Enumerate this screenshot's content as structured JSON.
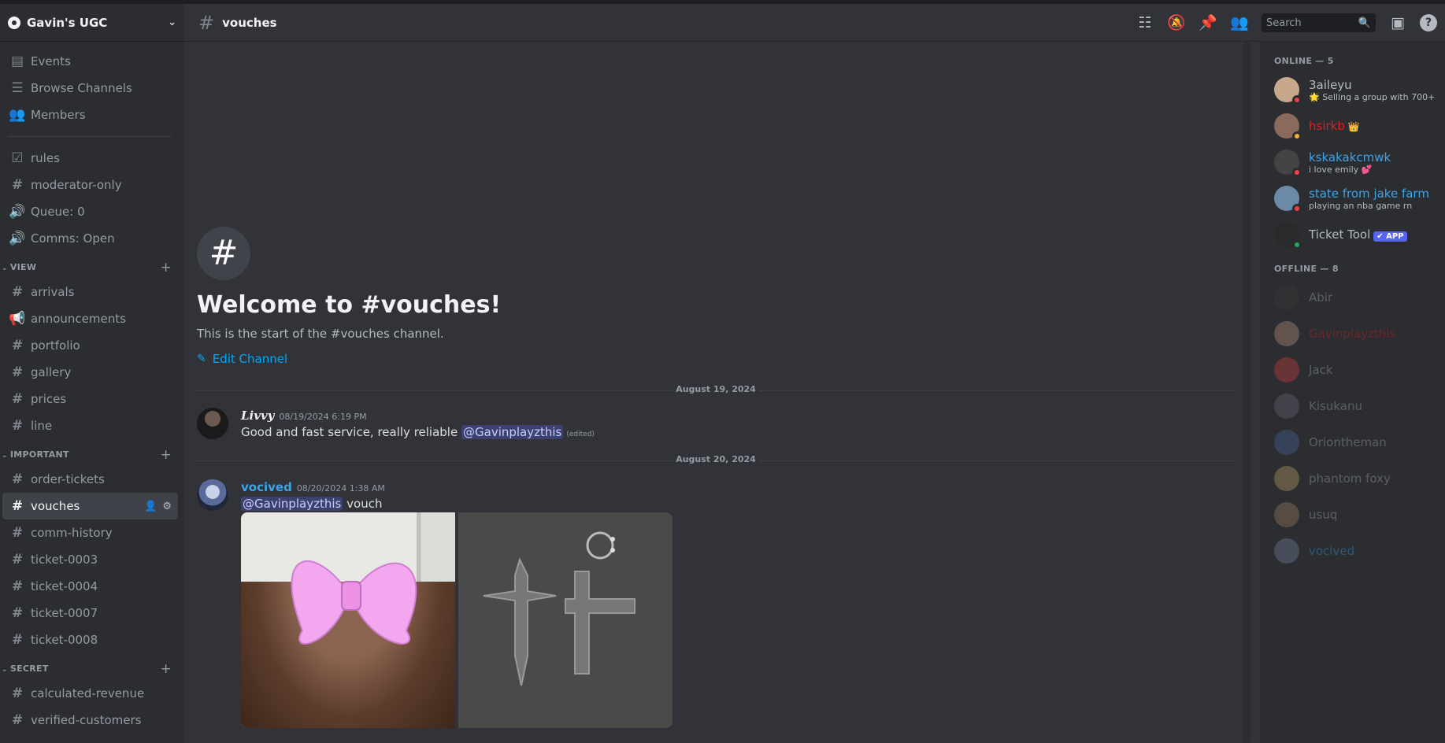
{
  "guild": {
    "name": "Gavin's UGC"
  },
  "sidebar": {
    "top_items": [
      {
        "label": "Events",
        "icon": "calendar-icon"
      },
      {
        "label": "Browse Channels",
        "icon": "browse-channels-icon"
      },
      {
        "label": "Members",
        "icon": "members-icon"
      }
    ],
    "ungrouped": [
      {
        "label": "rules",
        "icon": "rules-icon"
      },
      {
        "label": "moderator-only",
        "icon": "hash-icon"
      },
      {
        "label": "Queue: 0",
        "icon": "voice-icon"
      },
      {
        "label": "Comms: Open",
        "icon": "voice-icon"
      }
    ],
    "categories": [
      {
        "name": "VIEW",
        "channels": [
          "arrivals",
          "announcements",
          "portfolio",
          "gallery",
          "prices",
          "line"
        ]
      },
      {
        "name": "IMPORTANT",
        "channels": [
          "order-tickets",
          "vouches",
          "comm-history",
          "ticket-0003",
          "ticket-0004",
          "ticket-0007",
          "ticket-0008"
        ]
      },
      {
        "name": "SECRET",
        "channels": [
          "calculated-revenue",
          "verified-customers"
        ]
      }
    ],
    "active_channel": "vouches"
  },
  "topbar": {
    "channel": "vouches",
    "search_placeholder": "Search"
  },
  "welcome": {
    "title": "Welcome to #vouches!",
    "subtitle": "This is the start of the #vouches channel.",
    "edit_label": "Edit Channel"
  },
  "messages": [
    {
      "date": "August 19, 2024",
      "author": "Livvy",
      "author_color": "#f2f3f5",
      "timestamp": "08/19/2024 6:19 PM",
      "text": "Good and fast service, really reliable",
      "mention": "@Gavinplayzthis",
      "edited": "(edited)"
    },
    {
      "date": "August 20, 2024",
      "author": "vocived",
      "author_color": "#3ba5ec",
      "timestamp": "08/20/2024 1:38 AM",
      "mention": "@Gavinplayzthis",
      "text": "vouch"
    }
  ],
  "members": {
    "online_header": "ONLINE — 5",
    "offline_header": "OFFLINE — 8",
    "online": [
      {
        "name": "3aileyu",
        "color": "#b5bac1",
        "status": "🌟 Selling a group with 700+ ...",
        "presence": "dnd"
      },
      {
        "name": "hsirkb",
        "color": "#e01e1e",
        "badge": "👑",
        "status": "",
        "presence": "idle"
      },
      {
        "name": "kskakakcmwk",
        "color": "#3ba5ec",
        "status": "i love emily 💕",
        "presence": "dnd"
      },
      {
        "name": "state from jake farm",
        "color": "#3ba5ec",
        "status": "playing an nba game rn",
        "presence": "dnd"
      },
      {
        "name": "Ticket Tool",
        "color": "#b5bac1",
        "app": "✔ APP",
        "status": "",
        "presence": "online"
      }
    ],
    "offline": [
      {
        "name": "Abir",
        "color": "#b5bac1"
      },
      {
        "name": "Gavinplayzthis",
        "color": "#e01e1e"
      },
      {
        "name": "Jack",
        "color": "#b5bac1"
      },
      {
        "name": "Kisukanu",
        "color": "#b5bac1"
      },
      {
        "name": "Oriontheman",
        "color": "#b5bac1"
      },
      {
        "name": "phantom foxy",
        "color": "#b5bac1"
      },
      {
        "name": "usuq",
        "color": "#b5bac1"
      },
      {
        "name": "vocived",
        "color": "#3ba5ec"
      }
    ]
  }
}
